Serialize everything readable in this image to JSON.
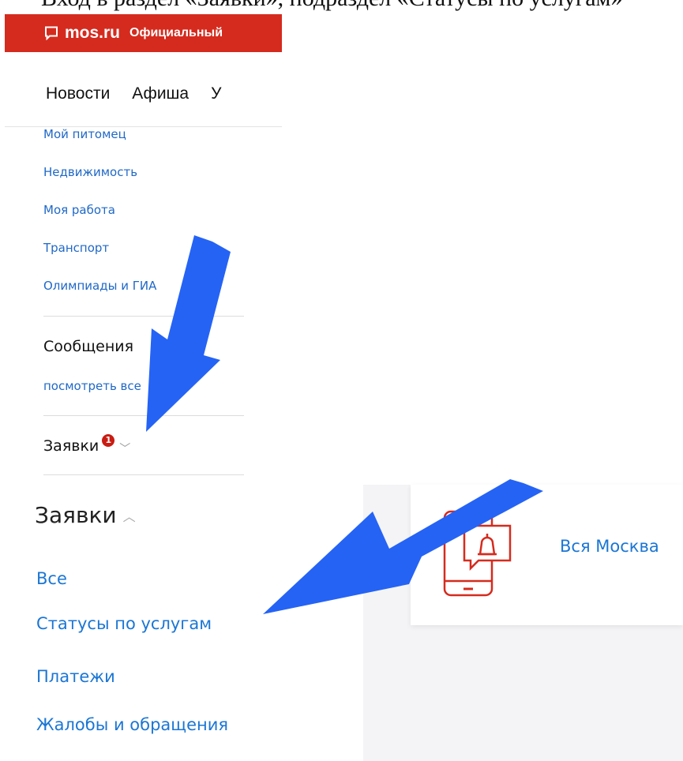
{
  "caption": {
    "text": "Вход в раздел «Заявки», подраздел «Статусы по услугам»"
  },
  "header": {
    "logo_text": "mos.ru",
    "logo_subtitle": "Официальный"
  },
  "nav": {
    "items": [
      "Новости",
      "Афиша",
      "У"
    ]
  },
  "sidebar": {
    "links": [
      "Мой питомец",
      "Недвижимость",
      "Моя работа",
      "Транспорт",
      "Олимпиады и ГИА"
    ],
    "messages": {
      "title": "Сообщения",
      "view_all": "посмотреть все"
    },
    "requests": {
      "label": "Заявки",
      "badge": "1"
    }
  },
  "requests_menu": {
    "title": "Заявки",
    "items": [
      "Все",
      "Статусы по услугам",
      "Платежи",
      "Жалобы и обращения"
    ]
  },
  "content": {
    "card_text": "Вся Москва"
  },
  "colors": {
    "brand_red": "#d52b1e",
    "link_blue": "#1b76d4",
    "arrow_blue": "#2563f5"
  }
}
